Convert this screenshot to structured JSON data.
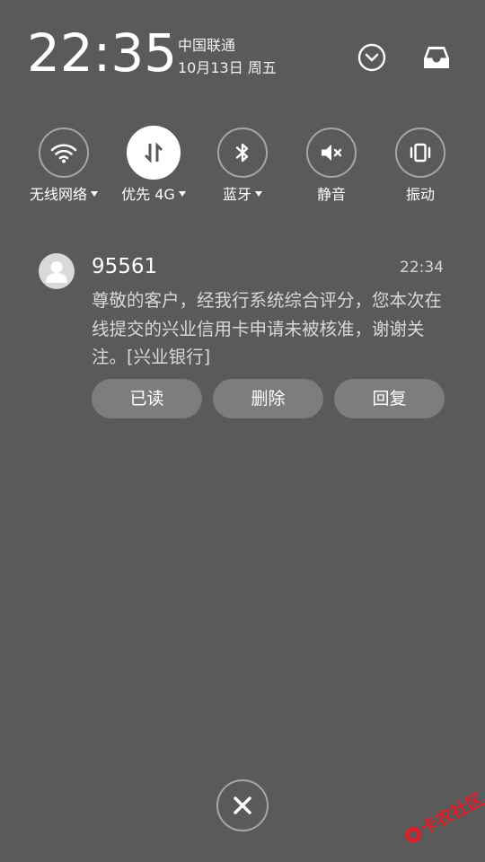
{
  "header": {
    "time": "22:35",
    "carrier": "中国联通",
    "date": "10月13日 周五",
    "expand_icon": "chevron-down-circle-icon",
    "inbox_icon": "inbox-tray-icon"
  },
  "toggles": [
    {
      "label": "无线网络",
      "icon": "wifi-icon",
      "active": false,
      "has_caret": true
    },
    {
      "label": "优先 4G",
      "icon": "mobile-data-icon",
      "active": true,
      "has_caret": true
    },
    {
      "label": "蓝牙",
      "icon": "bluetooth-icon",
      "active": false,
      "has_caret": true
    },
    {
      "label": "静音",
      "icon": "mute-icon",
      "active": false,
      "has_caret": false
    },
    {
      "label": "振动",
      "icon": "vibrate-icon",
      "active": false,
      "has_caret": false
    }
  ],
  "notification": {
    "sender": "95561",
    "time": "22:34",
    "body": "尊敬的客户，经我行系统综合评分，您本次在线提交的兴业信用卡申请未被核准，谢谢关注。[兴业银行]",
    "avatar_icon": "person-avatar-icon",
    "actions": [
      "已读",
      "删除",
      "回复"
    ]
  },
  "close_icon": "close-icon",
  "watermark": {
    "text": "卡农社区",
    "color": "#d8202a"
  }
}
